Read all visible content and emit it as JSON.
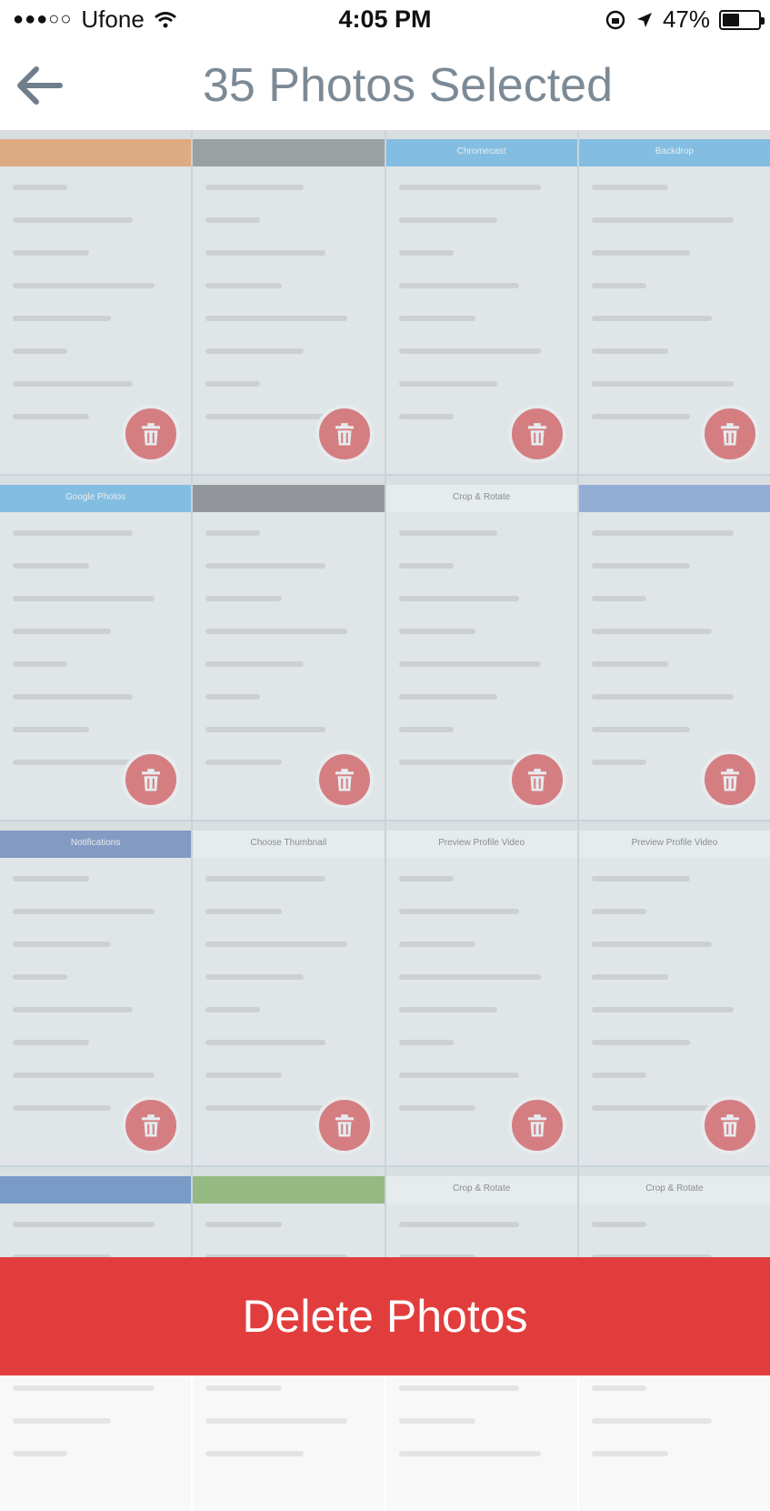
{
  "status_bar": {
    "carrier": "Ufone",
    "time": "4:05 PM",
    "battery": "47%",
    "battery_level": 0.47
  },
  "header": {
    "title": "35 Photos Selected"
  },
  "photos": [
    {
      "label": "",
      "theme": "#f08a3a"
    },
    {
      "label": "",
      "theme": "#777777"
    },
    {
      "label": "Chromecast",
      "theme": "#4aaee8"
    },
    {
      "label": "Backdrop",
      "theme": "#4aaee8"
    },
    {
      "label": "Google Photos",
      "theme": "#4aaee8"
    },
    {
      "label": "",
      "theme": "#666666"
    },
    {
      "label": "Crop & Rotate",
      "theme": "#ffffff"
    },
    {
      "label": "",
      "theme": "#6a8fd0"
    },
    {
      "label": "Notifications",
      "theme": "#4a6fb0"
    },
    {
      "label": "Choose Thumbnail",
      "theme": "#ffffff"
    },
    {
      "label": "Preview Profile Video",
      "theme": "#ffffff"
    },
    {
      "label": "Preview Profile Video",
      "theme": "#ffffff"
    },
    {
      "label": "",
      "theme": "#3a6cb8"
    },
    {
      "label": "",
      "theme": "#6aa63a"
    },
    {
      "label": "Crop & Rotate",
      "theme": "#ffffff"
    },
    {
      "label": "Crop & Rotate",
      "theme": "#ffffff"
    }
  ],
  "actions": {
    "delete_label": "Delete Photos"
  },
  "colors": {
    "accent_red": "#e23d3d",
    "title_gray": "#7c8a96"
  }
}
